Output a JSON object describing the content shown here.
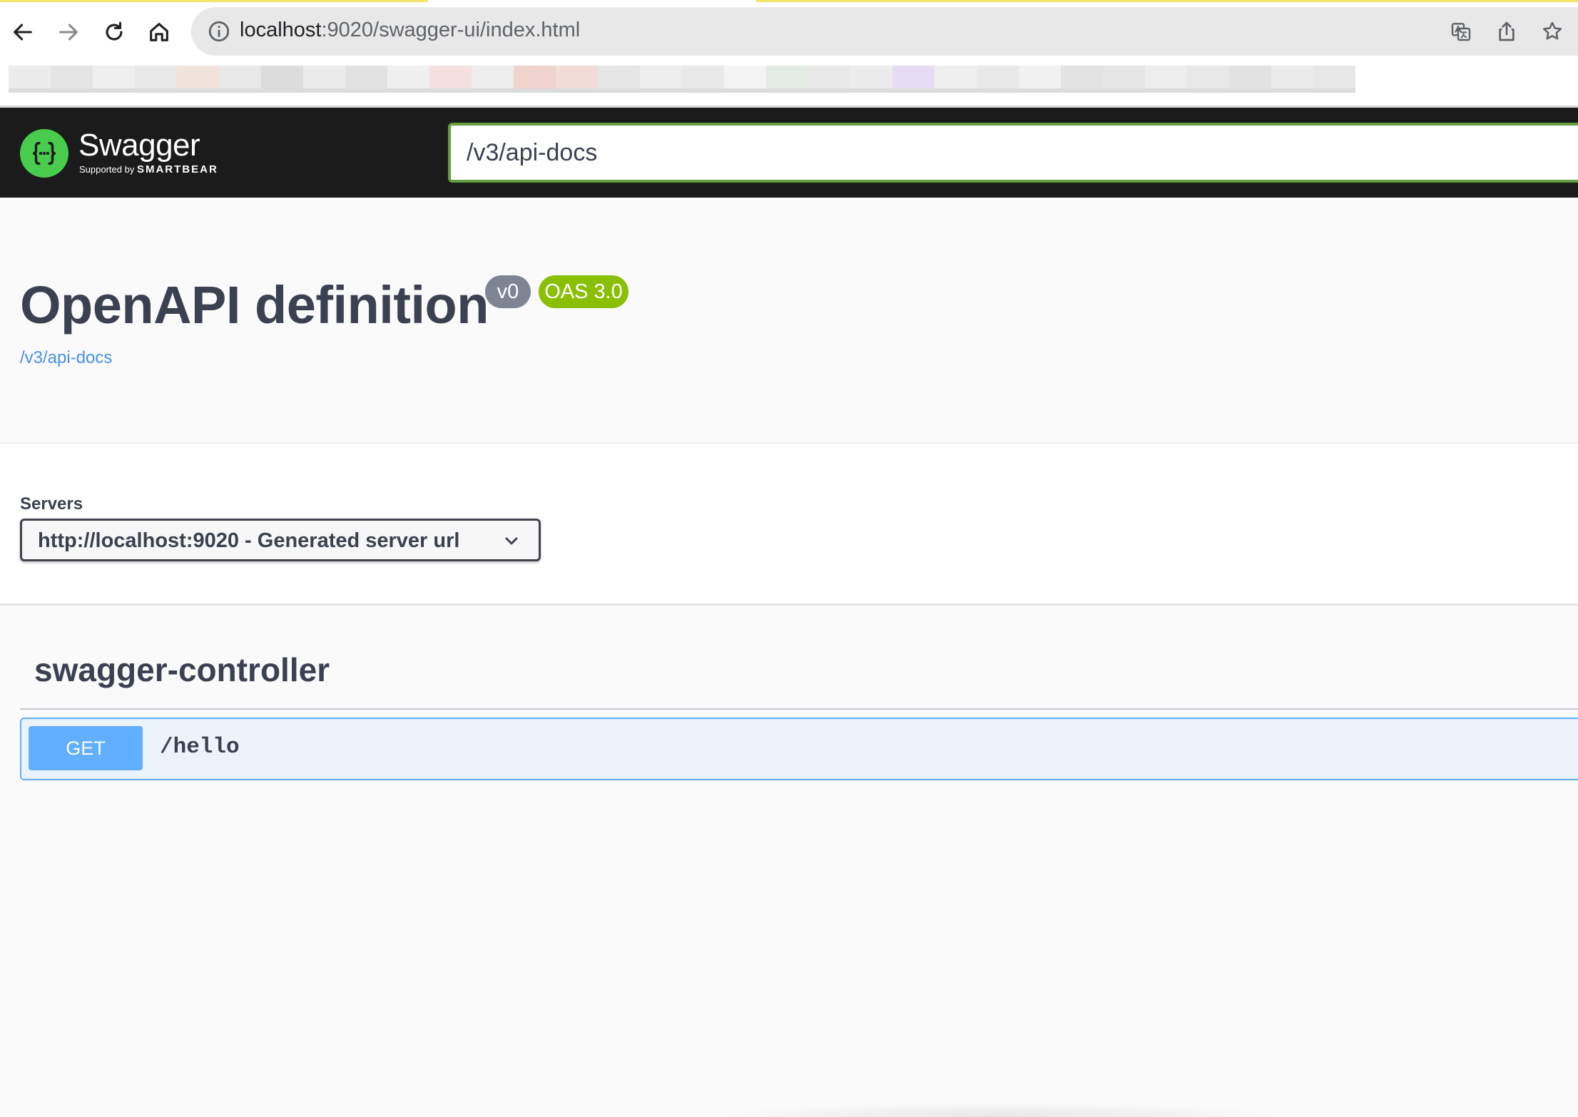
{
  "browser": {
    "url_host": "localhost",
    "url_rest": ":9020/swagger-ui/index.html",
    "bookmark_colors": [
      "#ececec",
      "#e4e4e4",
      "#efefef",
      "#e9e9e9",
      "#f2e2dc",
      "#e8e8e8",
      "#dcdcdc",
      "#ebebeb",
      "#e2e2e2",
      "#f0f0f0",
      "#f4e0e0",
      "#ededed",
      "#f0d3cc",
      "#f2dcd8",
      "#e6e6e6",
      "#eeeeee",
      "#e9e9e9",
      "#f4f4f4",
      "#e4ebe4",
      "#e8e8e8",
      "#ececec",
      "#e6dcf4",
      "#efefef",
      "#e9e9e9",
      "#f1f1f1",
      "#e3e3e3",
      "#e6e6e6",
      "#ededed",
      "#e8e8e8",
      "#e2e2e2",
      "#ebebeb",
      "#e7e7e7"
    ]
  },
  "topbar": {
    "brand": "Swagger",
    "brand_sub_prefix": "Supported by",
    "brand_sub_company": "SMARTBEAR",
    "definition_url": "/v3/api-docs",
    "accent_color": "#62a03f"
  },
  "info": {
    "title": "OpenAPI definition",
    "version": "v0",
    "oas": "OAS 3.0",
    "spec_link": "/v3/api-docs"
  },
  "servers": {
    "label": "Servers",
    "selected": "http://localhost:9020 - Generated server url"
  },
  "tags": [
    {
      "name": "swagger-controller",
      "operations": [
        {
          "method": "GET",
          "path": "/hello",
          "color": "#61affe"
        }
      ]
    }
  ]
}
